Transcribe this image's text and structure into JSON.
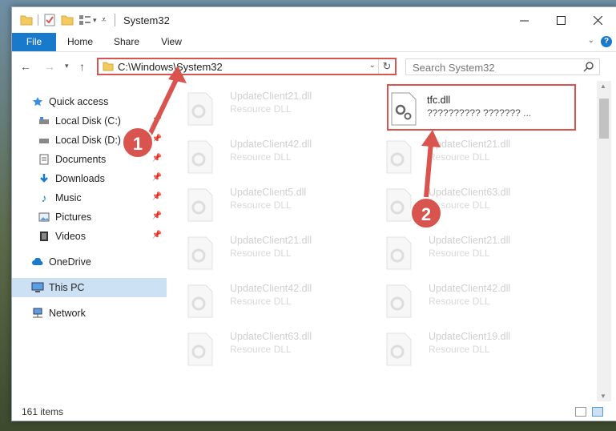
{
  "window": {
    "title": "System32"
  },
  "ribbon": {
    "tabs": [
      "File",
      "Home",
      "Share",
      "View"
    ],
    "help": "?"
  },
  "nav": {
    "back_icon": "back-arrow-icon",
    "forward_icon": "forward-arrow-icon",
    "recent_icon": "chevron-down-icon",
    "up_icon": "up-arrow-icon",
    "address_path": "C:\\Windows\\System32",
    "search_placeholder": "Search System32"
  },
  "sidebar": {
    "items": [
      {
        "label": "Quick access",
        "icon": "star-icon",
        "pinned": false
      },
      {
        "label": "Local Disk (C:)",
        "icon": "drive-icon",
        "pinned": true
      },
      {
        "label": "Local Disk (D:)",
        "icon": "drive-icon",
        "pinned": true
      },
      {
        "label": "Documents",
        "icon": "documents-icon",
        "pinned": true
      },
      {
        "label": "Downloads",
        "icon": "download-icon",
        "pinned": true
      },
      {
        "label": "Music",
        "icon": "music-icon",
        "pinned": true
      },
      {
        "label": "Pictures",
        "icon": "pictures-icon",
        "pinned": true
      },
      {
        "label": "Videos",
        "icon": "videos-icon",
        "pinned": true
      },
      {
        "label": "OneDrive",
        "icon": "cloud-icon",
        "pinned": false
      },
      {
        "label": "This PC",
        "icon": "computer-icon",
        "pinned": false,
        "selected": true
      },
      {
        "label": "Network",
        "icon": "network-icon",
        "pinned": false
      }
    ]
  },
  "files": {
    "left_column": [
      {
        "name": "UpdateClient21.dll",
        "desc": "Resource DLL"
      },
      {
        "name": "UpdateClient42.dll",
        "desc": "Resource DLL"
      },
      {
        "name": "UpdateClient5.dll",
        "desc": "Resource DLL"
      },
      {
        "name": "UpdateClient21.dll",
        "desc": "Resource DLL"
      },
      {
        "name": "UpdateClient42.dll",
        "desc": "Resource DLL"
      },
      {
        "name": "UpdateClient63.dll",
        "desc": "Resource DLL"
      }
    ],
    "right_column": [
      {
        "name": "tfc.dll",
        "desc": "?????????? ??????? ..."
      },
      {
        "name": "UpdateClient21.dll",
        "desc": "Resource DLL"
      },
      {
        "name": "UpdateClient63.dll",
        "desc": "Resource DLL"
      },
      {
        "name": "UpdateClient21.dll",
        "desc": "Resource DLL"
      },
      {
        "name": "UpdateClient42.dll",
        "desc": "Resource DLL"
      },
      {
        "name": "UpdateClient19.dll",
        "desc": "Resource DLL"
      }
    ]
  },
  "status": {
    "count": "161 items"
  },
  "callouts": {
    "one": "1",
    "two": "2"
  },
  "colors": {
    "accent": "#1979ca",
    "highlight": "#d9534f",
    "selected": "#cce1f4"
  }
}
